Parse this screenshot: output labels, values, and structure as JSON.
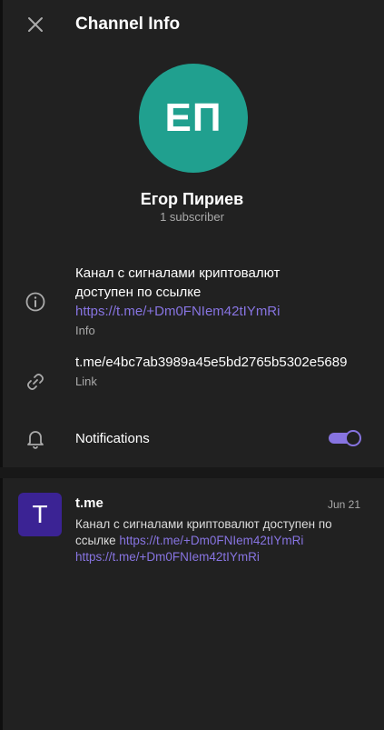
{
  "header": {
    "title": "Channel Info",
    "close_icon": "close-icon"
  },
  "profile": {
    "initials": "ЕП",
    "avatar_color": "#20a08f",
    "name": "Егор Пириев",
    "subscribers": "1 subscriber"
  },
  "info": {
    "description_line1": "Канал с сигналами криптовалют",
    "description_line2": "доступен по ссылке",
    "description_link": "https://t.me/+Dm0FNIem42tIYmRi",
    "caption": "Info",
    "icon": "info-icon"
  },
  "link_row": {
    "value": "t.me/e4bc7ab3989a45e5bd2765b5302e5689",
    "caption": "Link",
    "icon": "link-icon"
  },
  "notifications": {
    "label": "Notifications",
    "enabled": true,
    "icon": "bell-icon"
  },
  "post": {
    "thumb_letter": "T",
    "thumb_color": "#3b2394",
    "title": "t.me",
    "date": "Jun 21",
    "text": "Канал с сигналами криптовалют доступен по ссылке",
    "link1": "https://t.me/+Dm0FNIem42tIYmRi",
    "link2": "https://t.me/+Dm0FNIem42tIYmRi"
  },
  "colors": {
    "accent": "#8774e1",
    "background": "#212121",
    "secondary_text": "#aaaaaa"
  }
}
